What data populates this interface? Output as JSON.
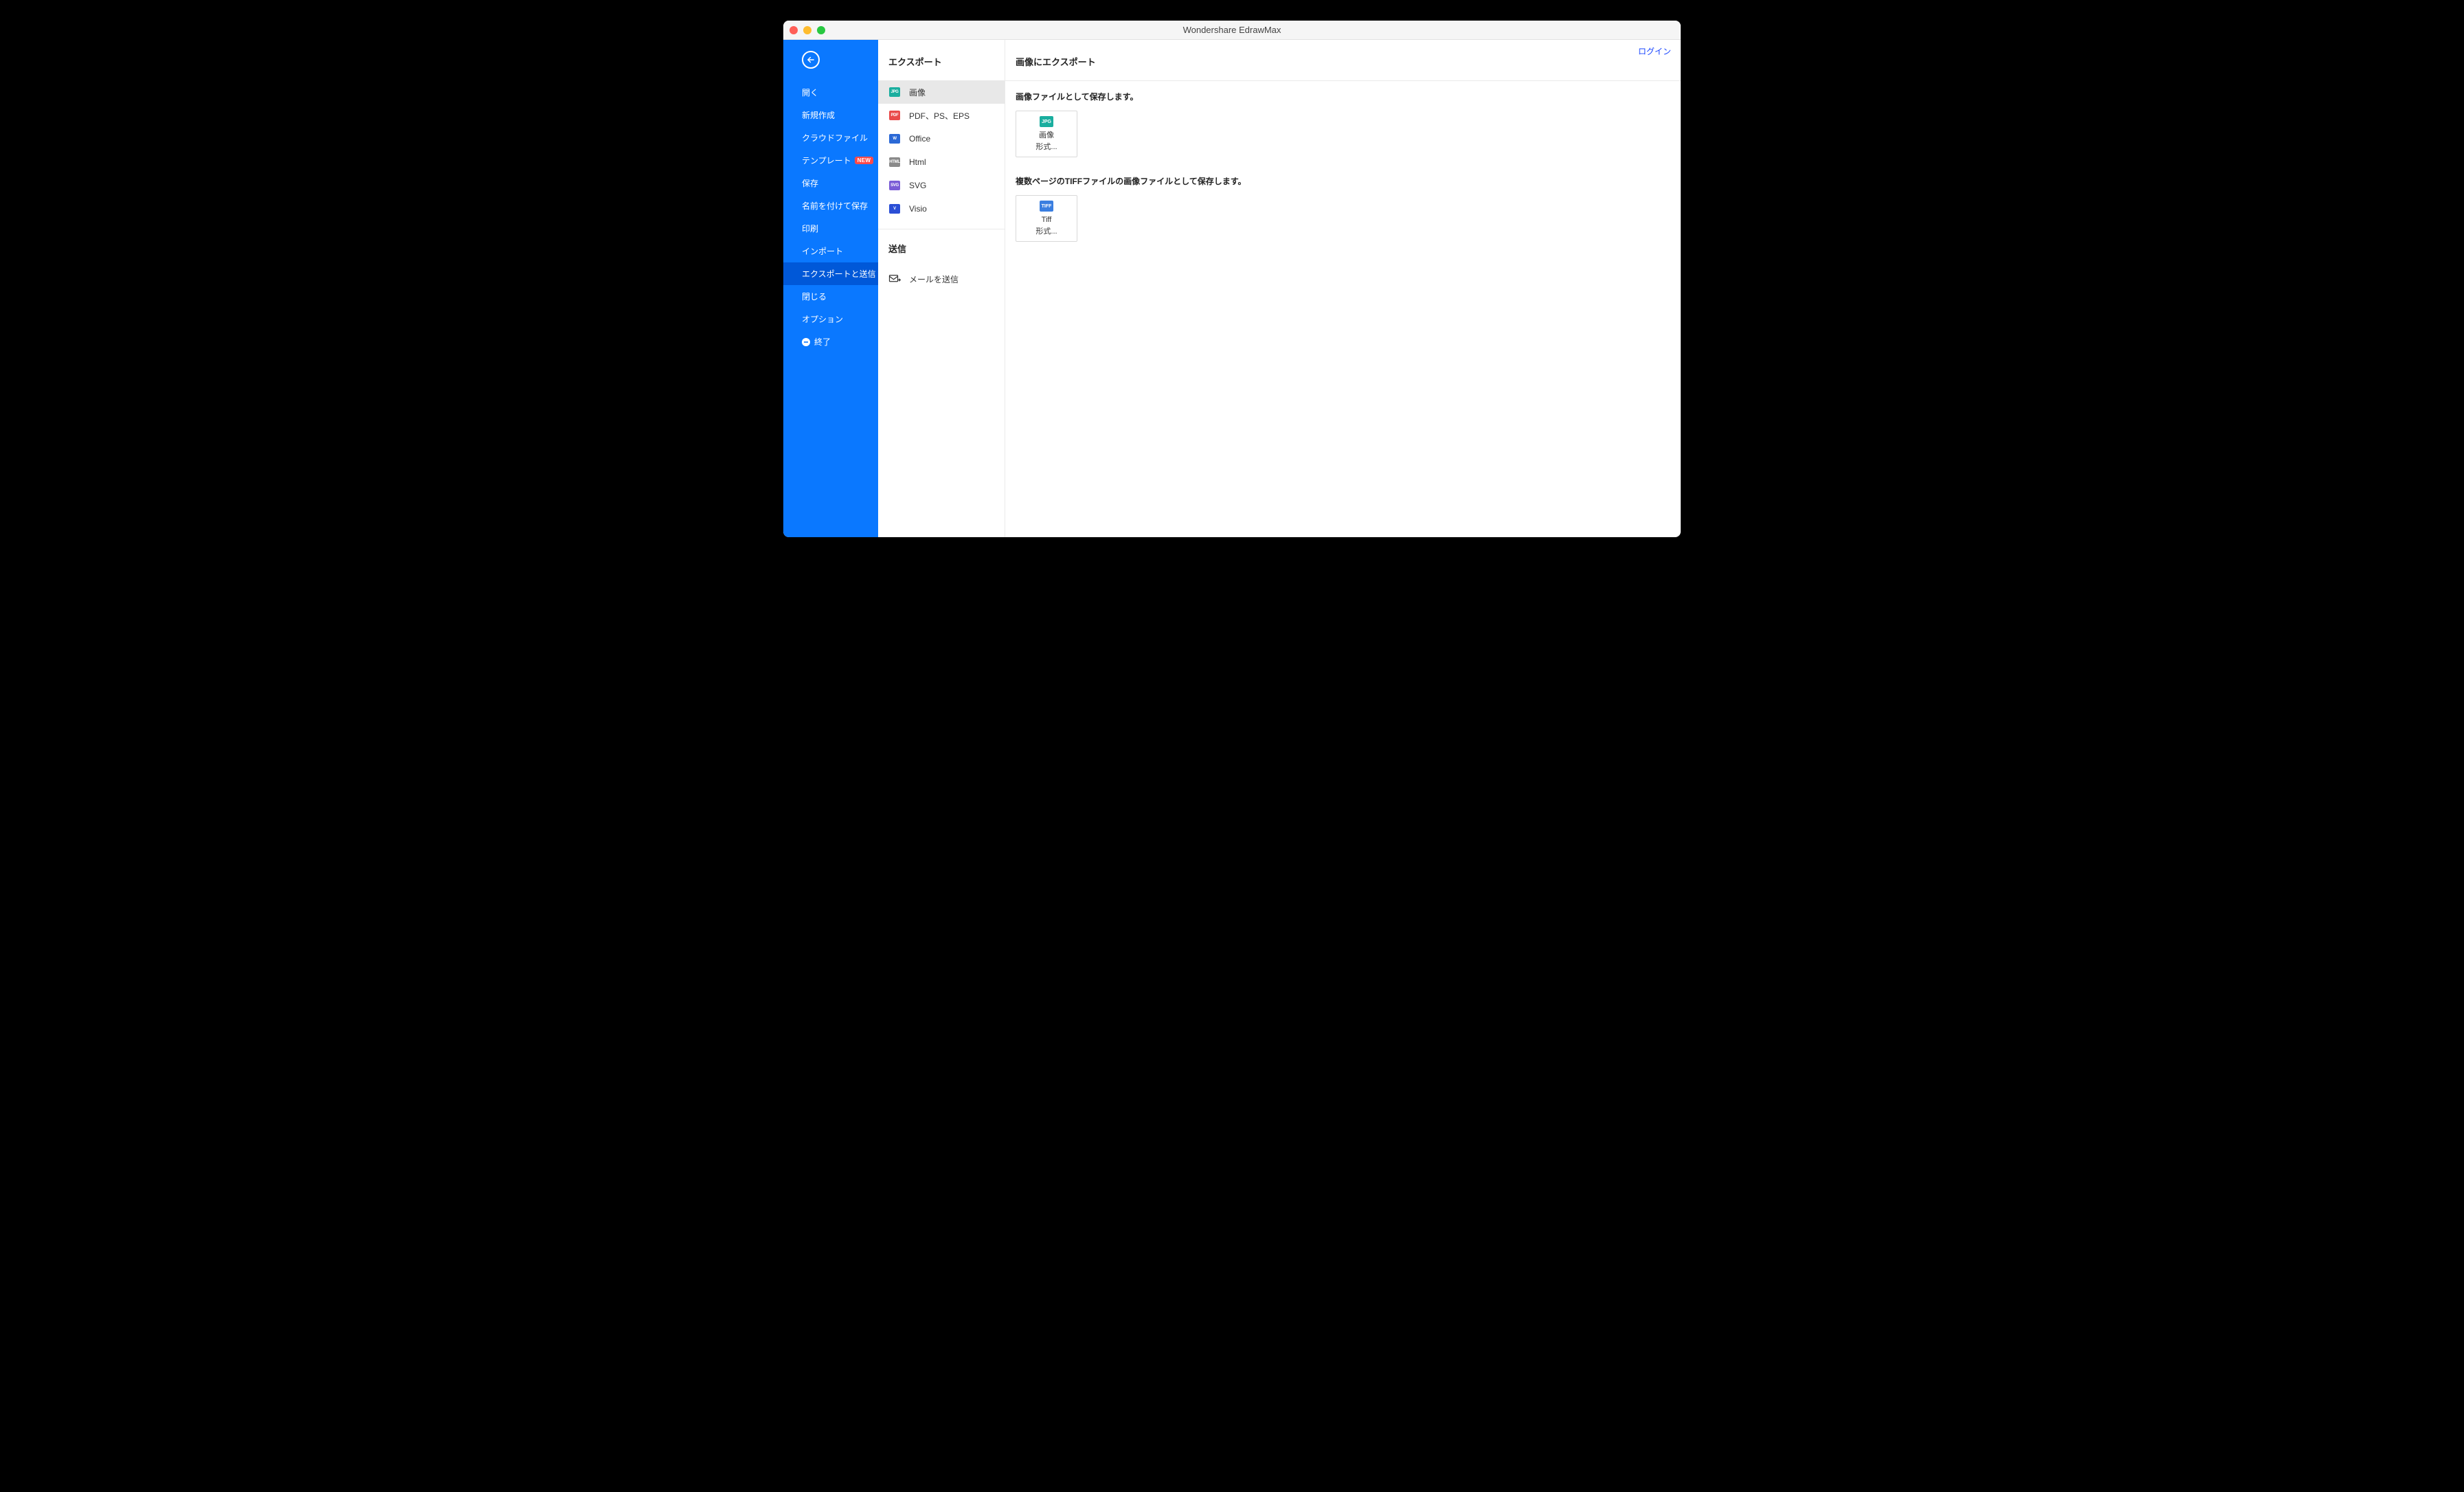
{
  "window": {
    "title": "Wondershare EdrawMax"
  },
  "topbar": {
    "login": "ログイン"
  },
  "sidebar": {
    "items": [
      {
        "label": "開く"
      },
      {
        "label": "新規作成"
      },
      {
        "label": "クラウドファイル"
      },
      {
        "label": "テンプレート",
        "badge": "NEW"
      },
      {
        "label": "保存"
      },
      {
        "label": "名前を付けて保存"
      },
      {
        "label": "印刷"
      },
      {
        "label": "インポート"
      },
      {
        "label": "エクスポートと送信",
        "active": true
      },
      {
        "label": "閉じる"
      },
      {
        "label": "オプション"
      },
      {
        "label": "終了",
        "exit": true
      }
    ]
  },
  "mid": {
    "header": "エクスポート",
    "items": [
      {
        "label": "画像",
        "iconText": "JPG",
        "iconColor": "#1aae9f",
        "selected": true
      },
      {
        "label": "PDF、PS、EPS",
        "iconText": "PDF",
        "iconColor": "#e94b4b"
      },
      {
        "label": "Office",
        "iconText": "W",
        "iconColor": "#2b69d6"
      },
      {
        "label": "Html",
        "iconText": "HTML",
        "iconColor": "#8a8a8a"
      },
      {
        "label": "SVG",
        "iconText": "SVG",
        "iconColor": "#7a5cd6"
      },
      {
        "label": "Visio",
        "iconText": "V",
        "iconColor": "#2b4fd6"
      }
    ],
    "send_header": "送信",
    "send_item": {
      "label": "メールを送信"
    }
  },
  "main": {
    "header": "画像にエクスポート",
    "section1_title": "画像ファイルとして保存します。",
    "tile1": {
      "iconText": "JPG",
      "iconColor": "#1aae9f",
      "line1": "画像",
      "line2": "形式..."
    },
    "section2_title": "複数ページのTIFFファイルの画像ファイルとして保存します。",
    "tile2": {
      "iconText": "TIFF",
      "iconColor": "#3a7ee0",
      "line1": "Tiff",
      "line2": "形式..."
    }
  }
}
